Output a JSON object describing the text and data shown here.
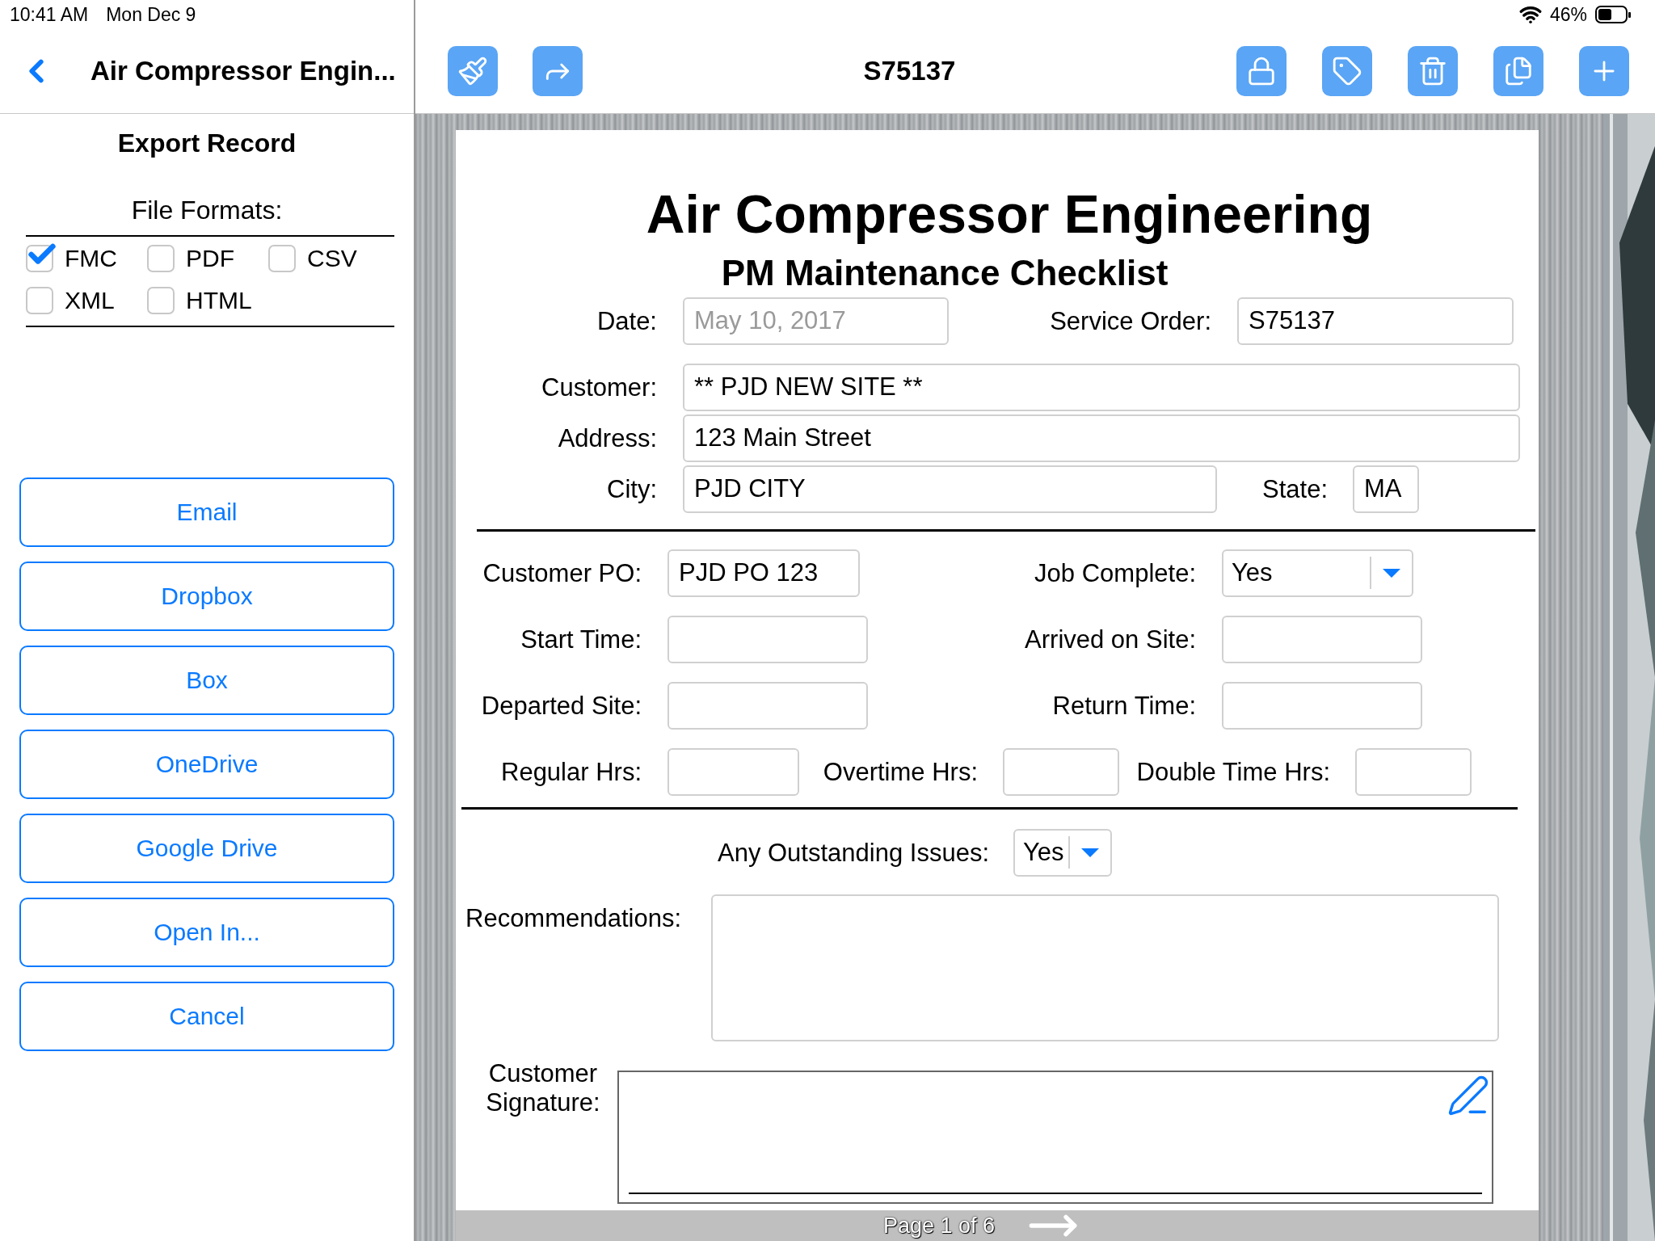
{
  "status_bar": {
    "time": "10:41 AM",
    "date": "Mon Dec 9",
    "battery": "46%"
  },
  "sidebar": {
    "nav_title": "Air Compressor Engin...",
    "heading": "Export Record",
    "formats_label": "File Formats:",
    "formats": [
      {
        "label": "FMC",
        "checked": true
      },
      {
        "label": "PDF",
        "checked": false
      },
      {
        "label": "CSV",
        "checked": false
      },
      {
        "label": "XML",
        "checked": false
      },
      {
        "label": "HTML",
        "checked": false
      }
    ],
    "actions": [
      "Email",
      "Dropbox",
      "Box",
      "OneDrive",
      "Google Drive",
      "Open In...",
      "Cancel"
    ]
  },
  "toolbar": {
    "title": "S75137"
  },
  "form": {
    "title": "Air Compressor Engineering",
    "subtitle": "PM Maintenance Checklist",
    "sections": [
      {
        "rows": [
          {
            "fields": [
              {
                "label": "Date:",
                "placeholder": "May 10, 2017",
                "kind": "text"
              },
              {
                "label": "Service Order:",
                "value": "S75137",
                "kind": "text"
              }
            ]
          },
          {
            "fields": [
              {
                "label": "Customer:",
                "value": "** PJD NEW SITE **",
                "kind": "text"
              }
            ]
          },
          {
            "fields": [
              {
                "label": "Address:",
                "value": "123 Main Street",
                "kind": "text"
              }
            ]
          },
          {
            "fields": [
              {
                "label": "City:",
                "value": "PJD CITY",
                "kind": "text"
              },
              {
                "label": "State:",
                "value": "MA",
                "kind": "text"
              }
            ]
          }
        ]
      },
      {
        "rows": [
          {
            "fields": [
              {
                "label": "Customer PO:",
                "value": "PJD PO 123",
                "kind": "text"
              },
              {
                "label": "Job Complete:",
                "value": "Yes",
                "kind": "dropdown"
              }
            ]
          },
          {
            "fields": [
              {
                "label": "Start Time:",
                "kind": "text"
              },
              {
                "label": "Arrived on Site:",
                "kind": "text"
              }
            ]
          },
          {
            "fields": [
              {
                "label": "Departed Site:",
                "kind": "text"
              },
              {
                "label": "Return Time:",
                "kind": "text"
              }
            ]
          },
          {
            "fields": [
              {
                "label": "Regular Hrs:",
                "kind": "text"
              },
              {
                "label": "Overtime Hrs:",
                "kind": "text"
              },
              {
                "label": "Double Time Hrs:",
                "kind": "text"
              }
            ]
          }
        ]
      },
      {
        "rows": [
          {
            "fields": [
              {
                "label": "Any Outstanding Issues:",
                "value": "Yes",
                "kind": "dropdown"
              }
            ]
          },
          {
            "fields": [
              {
                "label": "Recommendations:",
                "kind": "textarea"
              }
            ]
          },
          {
            "fields": [
              {
                "label": "Customer Signature:",
                "kind": "signature"
              }
            ]
          }
        ]
      }
    ],
    "footer": "Page 1 of 6"
  }
}
